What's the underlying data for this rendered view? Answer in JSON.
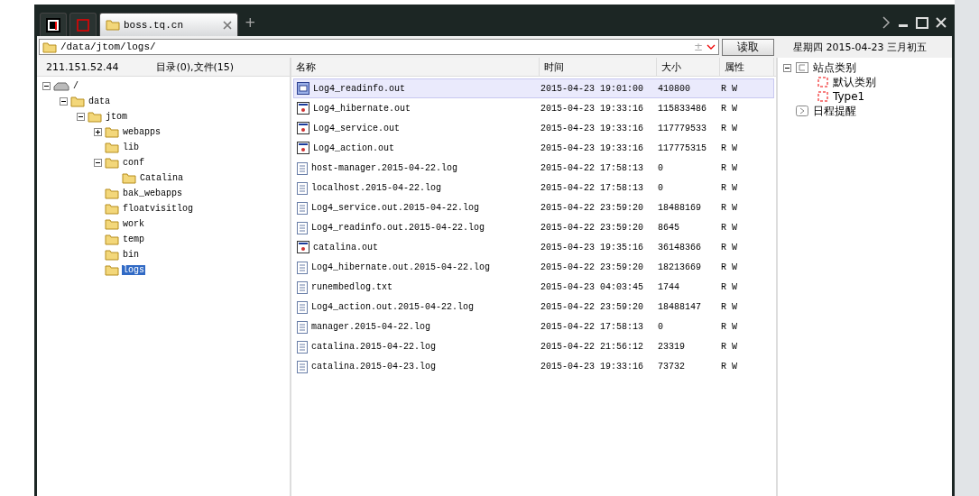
{
  "tabs": [
    {
      "kind": "app",
      "selected": false
    },
    {
      "kind": "screen",
      "selected": false
    },
    {
      "kind": "folder",
      "label": "boss.tq.cn",
      "selected": true
    }
  ],
  "add_tab": "+",
  "path_bar": {
    "value": "/data/jtom/logs/",
    "plus": "±",
    "read_button": "读取"
  },
  "date_bar": "星期四 2015-04-23 三月初五",
  "left_header": {
    "host": "211.151.52.44",
    "summary": "目录(0),文件(15)"
  },
  "tree": [
    {
      "label": "/",
      "kind": "drive",
      "expanded": true,
      "selected": false,
      "children": [
        {
          "label": "data",
          "kind": "folder",
          "expanded": true,
          "selected": false,
          "children": [
            {
              "label": "jtom",
              "kind": "folder",
              "expanded": true,
              "selected": false,
              "children": [
                {
                  "label": "webapps",
                  "kind": "folder",
                  "expanded": false,
                  "selected": false
                },
                {
                  "label": "lib",
                  "kind": "folder",
                  "selected": false
                },
                {
                  "label": "conf",
                  "kind": "folder",
                  "expanded": true,
                  "selected": false,
                  "children": [
                    {
                      "label": "Catalina",
                      "kind": "folder",
                      "selected": false
                    }
                  ]
                },
                {
                  "label": "bak_webapps",
                  "kind": "folder",
                  "selected": false
                },
                {
                  "label": "floatvisitlog",
                  "kind": "folder",
                  "selected": false
                },
                {
                  "label": "work",
                  "kind": "folder",
                  "selected": false
                },
                {
                  "label": "temp",
                  "kind": "folder",
                  "selected": false
                },
                {
                  "label": "bin",
                  "kind": "folder",
                  "selected": false
                },
                {
                  "label": "logs",
                  "kind": "folder",
                  "selected": true
                }
              ]
            }
          ]
        }
      ]
    }
  ],
  "table": {
    "columns": [
      "名称",
      "时间",
      "大小",
      "属性"
    ],
    "rows": [
      {
        "kind": "binary",
        "name": "Log4_readinfo.out",
        "time": "2015-04-23 19:01:00",
        "size": "410800",
        "attr": "R W",
        "selected": true
      },
      {
        "kind": "app",
        "name": "Log4_hibernate.out",
        "time": "2015-04-23 19:33:16",
        "size": "115833486",
        "attr": "R W",
        "selected": false
      },
      {
        "kind": "app",
        "name": "Log4_service.out",
        "time": "2015-04-23 19:33:16",
        "size": "117779533",
        "attr": "R W",
        "selected": false
      },
      {
        "kind": "app",
        "name": "Log4_action.out",
        "time": "2015-04-23 19:33:16",
        "size": "117775315",
        "attr": "R W",
        "selected": false
      },
      {
        "kind": "text",
        "name": "host-manager.2015-04-22.log",
        "time": "2015-04-22 17:58:13",
        "size": "0",
        "attr": "R W",
        "selected": false
      },
      {
        "kind": "text",
        "name": "localhost.2015-04-22.log",
        "time": "2015-04-22 17:58:13",
        "size": "0",
        "attr": "R W",
        "selected": false
      },
      {
        "kind": "text",
        "name": "Log4_service.out.2015-04-22.log",
        "time": "2015-04-22 23:59:20",
        "size": "18488169",
        "attr": "R W",
        "selected": false
      },
      {
        "kind": "text",
        "name": "Log4_readinfo.out.2015-04-22.log",
        "time": "2015-04-22 23:59:20",
        "size": "8645",
        "attr": "R W",
        "selected": false
      },
      {
        "kind": "app",
        "name": "catalina.out",
        "time": "2015-04-23 19:35:16",
        "size": "36148366",
        "attr": "R W",
        "selected": false
      },
      {
        "kind": "text",
        "name": "Log4_hibernate.out.2015-04-22.log",
        "time": "2015-04-22 23:59:20",
        "size": "18213669",
        "attr": "R W",
        "selected": false
      },
      {
        "kind": "text",
        "name": "runembedlog.txt",
        "time": "2015-04-23 04:03:45",
        "size": "1744",
        "attr": "R W",
        "selected": false
      },
      {
        "kind": "text",
        "name": "Log4_action.out.2015-04-22.log",
        "time": "2015-04-22 23:59:20",
        "size": "18488147",
        "attr": "R W",
        "selected": false
      },
      {
        "kind": "text",
        "name": "manager.2015-04-22.log",
        "time": "2015-04-22 17:58:13",
        "size": "0",
        "attr": "R W",
        "selected": false
      },
      {
        "kind": "text",
        "name": "catalina.2015-04-22.log",
        "time": "2015-04-22 21:56:12",
        "size": "23319",
        "attr": "R W",
        "selected": false
      },
      {
        "kind": "text",
        "name": "catalina.2015-04-23.log",
        "time": "2015-04-23 19:33:16",
        "size": "73732",
        "attr": "R W",
        "selected": false
      }
    ]
  },
  "side_tree": [
    {
      "label": "站点类别",
      "kind": "group",
      "expanded": true,
      "children": [
        {
          "label": "默认类别",
          "kind": "category"
        },
        {
          "label": "Type1",
          "kind": "category"
        }
      ]
    },
    {
      "label": "日程提醒",
      "kind": "reminder"
    }
  ]
}
